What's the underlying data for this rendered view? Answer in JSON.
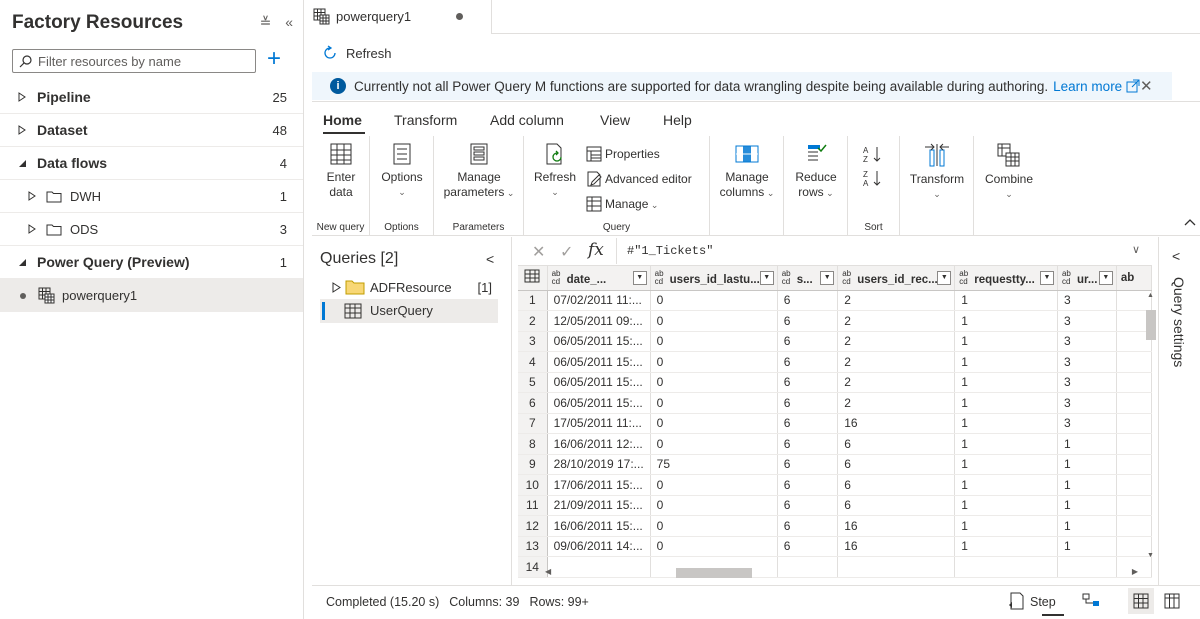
{
  "sidebar": {
    "title": "Factory Resources",
    "collapse_all_glyph": "≚",
    "collapse_pane_glyph": "«",
    "search_placeholder": "Filter resources by name",
    "add_glyph": "+",
    "items": [
      {
        "label": "Pipeline",
        "count": "25",
        "expanded": false
      },
      {
        "label": "Dataset",
        "count": "48",
        "expanded": false
      },
      {
        "label": "Data flows",
        "count": "4",
        "expanded": true,
        "children": [
          {
            "label": "DWH",
            "count": "1"
          },
          {
            "label": "ODS",
            "count": "3"
          }
        ]
      },
      {
        "label": "Power Query (Preview)",
        "count": "1",
        "expanded": true,
        "children": [
          {
            "label": "powerquery1",
            "selected": true
          }
        ]
      }
    ]
  },
  "tab": {
    "title": "powerquery1",
    "unsaved": true
  },
  "toolbar": {
    "refresh_label": "Refresh"
  },
  "info_banner": {
    "message": "Currently not all Power Query M functions are supported for data wrangling despite being available during authoring.",
    "link": "Learn more",
    "close_glyph": "✕"
  },
  "ribbon": {
    "tabs": [
      "Home",
      "Transform",
      "Add column",
      "View",
      "Help"
    ],
    "active_tab": "Home",
    "groups": {
      "new_query": {
        "label": "New query",
        "enter_data_line1": "Enter",
        "enter_data_line2": "data"
      },
      "options": {
        "label": "Options",
        "options_btn": "Options"
      },
      "parameters": {
        "label": "Parameters",
        "manage_line1": "Manage",
        "manage_line2": "parameters"
      },
      "query": {
        "label": "Query",
        "refresh": "Refresh",
        "properties": "Properties",
        "advanced_editor": "Advanced editor",
        "manage": "Manage"
      },
      "columns": {
        "manage_line1": "Manage",
        "manage_line2": "columns"
      },
      "rows": {
        "reduce_line1": "Reduce",
        "reduce_line2": "rows"
      },
      "sort": {
        "label": "Sort"
      },
      "transform": {
        "label": "Transform"
      },
      "combine": {
        "label": "Combine"
      }
    },
    "collapse_glyph": "^"
  },
  "queries_pane": {
    "title": "Queries [2]",
    "collapse_glyph": "<",
    "items": [
      {
        "label": "ADFResource",
        "count": "[1]",
        "type": "folder"
      },
      {
        "label": "UserQuery",
        "type": "table",
        "selected": true
      }
    ]
  },
  "formula_bar": {
    "cancel_glyph": "✕",
    "commit_glyph": "✓",
    "fx": "fx",
    "formula": "#\"1_Tickets\"",
    "expand_glyph": "∨"
  },
  "grid": {
    "type_badge_top": "ab",
    "type_badge_bottom": "cd",
    "columns": [
      "date_...",
      "users_id_lastu...",
      "s...",
      "users_id_rec...",
      "requestty...",
      "ur...",
      "ab"
    ],
    "rows": [
      [
        "1",
        "07/02/2011 11:...",
        "0",
        "6",
        "2",
        "1",
        "3"
      ],
      [
        "2",
        "12/05/2011 09:...",
        "0",
        "6",
        "2",
        "1",
        "3"
      ],
      [
        "3",
        "06/05/2011 15:...",
        "0",
        "6",
        "2",
        "1",
        "3"
      ],
      [
        "4",
        "06/05/2011 15:...",
        "0",
        "6",
        "2",
        "1",
        "3"
      ],
      [
        "5",
        "06/05/2011 15:...",
        "0",
        "6",
        "2",
        "1",
        "3"
      ],
      [
        "6",
        "06/05/2011 15:...",
        "0",
        "6",
        "2",
        "1",
        "3"
      ],
      [
        "7",
        "17/05/2011 11:...",
        "0",
        "6",
        "16",
        "1",
        "3"
      ],
      [
        "8",
        "16/06/2011 12:...",
        "0",
        "6",
        "6",
        "1",
        "1"
      ],
      [
        "9",
        "28/10/2019 17:...",
        "75",
        "6",
        "6",
        "1",
        "1"
      ],
      [
        "10",
        "17/06/2011 15:...",
        "0",
        "6",
        "6",
        "1",
        "1"
      ],
      [
        "11",
        "21/09/2011 15:...",
        "0",
        "6",
        "6",
        "1",
        "1"
      ],
      [
        "12",
        "16/06/2011 15:...",
        "0",
        "6",
        "16",
        "1",
        "1"
      ],
      [
        "13",
        "09/06/2011 14:...",
        "0",
        "6",
        "16",
        "1",
        "1"
      ],
      [
        "14",
        "",
        "",
        "",
        "",
        "",
        ""
      ]
    ]
  },
  "query_settings": {
    "label": "Query settings",
    "expand_glyph": "<"
  },
  "status_bar": {
    "completed": "Completed (15.20 s)",
    "columns": "Columns: 39",
    "rows": "Rows: 99+",
    "step": "Step"
  }
}
